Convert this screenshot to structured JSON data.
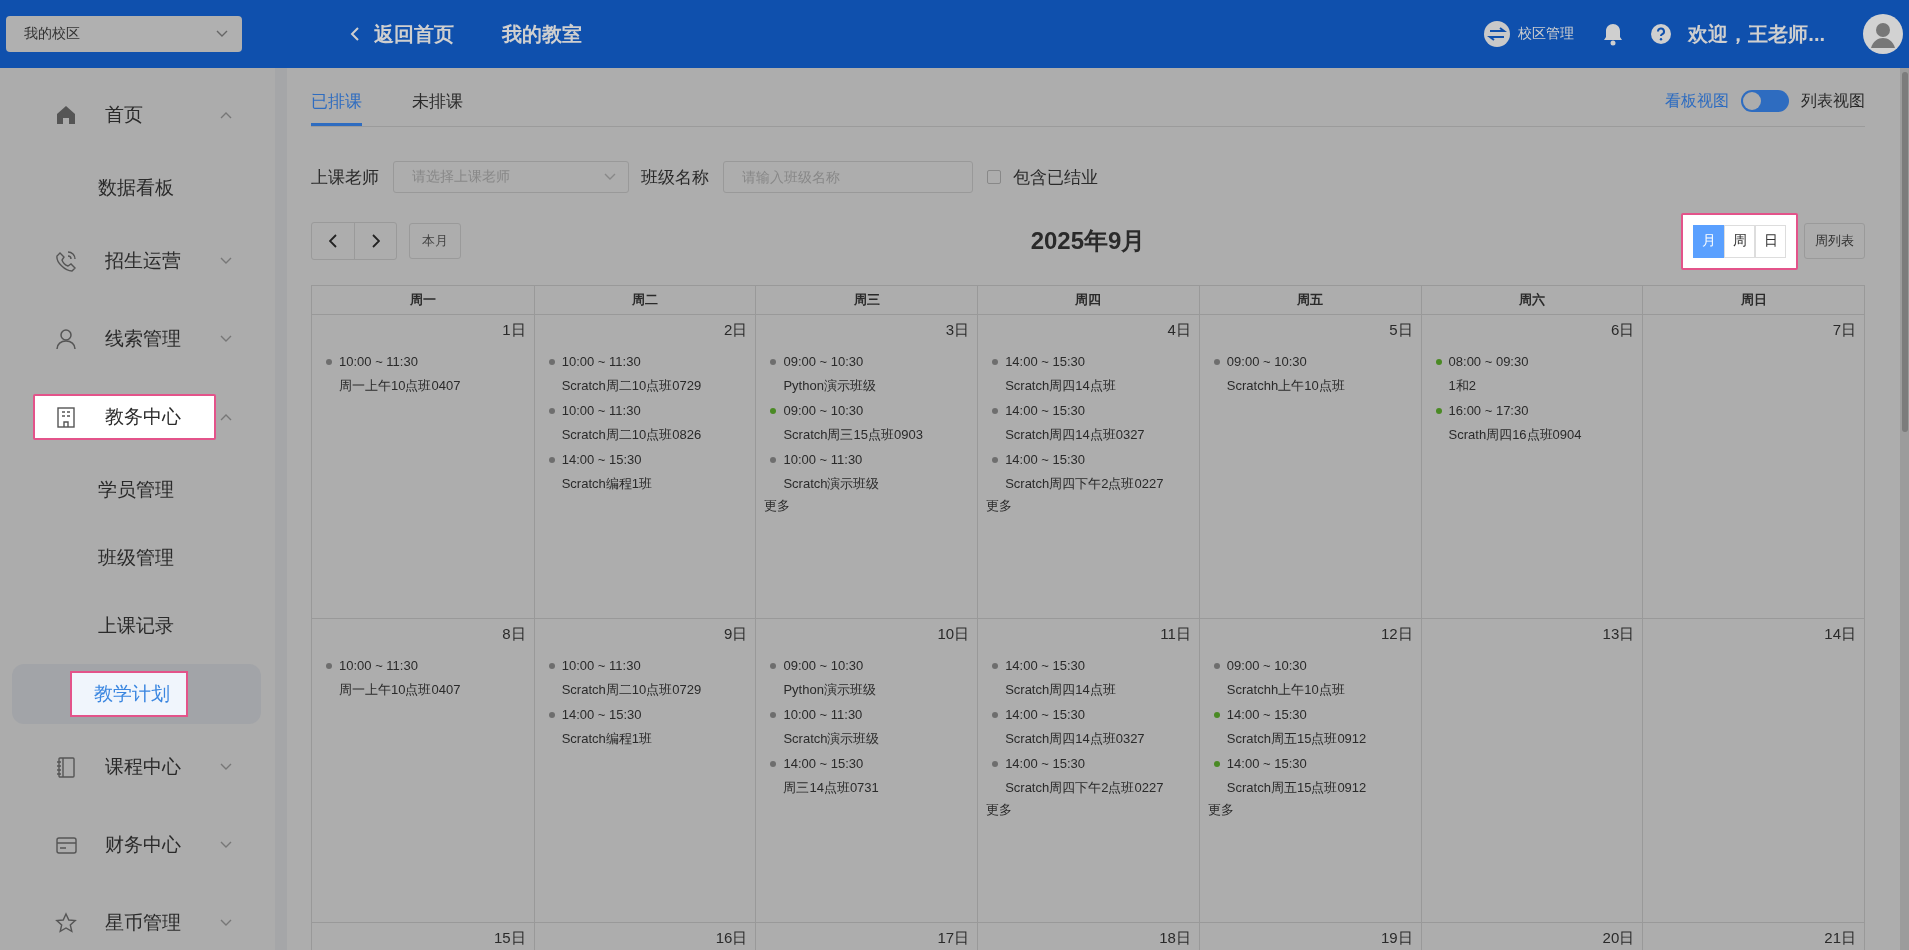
{
  "topbar": {
    "campus_select": {
      "value": "我的校区"
    },
    "back_link": "返回首页",
    "title": "我的教室",
    "campus_manage": "校区管理",
    "greeting": "欢迎，王老师..."
  },
  "sidebar": {
    "items": [
      {
        "label": "首页",
        "expanded": true,
        "highlighted": false,
        "children": [
          {
            "label": "数据看板",
            "selected": false,
            "highlighted": false
          }
        ]
      },
      {
        "label": "招生运营",
        "expanded": false,
        "highlighted": false
      },
      {
        "label": "线索管理",
        "expanded": false,
        "highlighted": false
      },
      {
        "label": "教务中心",
        "expanded": true,
        "highlighted": true,
        "children": [
          {
            "label": "学员管理",
            "selected": false,
            "highlighted": false
          },
          {
            "label": "班级管理",
            "selected": false,
            "highlighted": false
          },
          {
            "label": "上课记录",
            "selected": false,
            "highlighted": false
          },
          {
            "label": "教学计划",
            "selected": true,
            "highlighted": true
          }
        ]
      },
      {
        "label": "课程中心",
        "expanded": false,
        "highlighted": false
      },
      {
        "label": "财务中心",
        "expanded": false,
        "highlighted": false
      },
      {
        "label": "星币管理",
        "expanded": false,
        "highlighted": false
      }
    ]
  },
  "tabs": [
    {
      "label": "已排课",
      "selected": true
    },
    {
      "label": "未排课",
      "selected": false
    }
  ],
  "view_toggle": {
    "left_label": "看板视图",
    "right_label": "列表视图",
    "on": false
  },
  "filters": {
    "teacher_label": "上课老师",
    "teacher_select": {
      "placeholder": "请选择上课老师"
    },
    "class_label": "班级名称",
    "class_input": {
      "placeholder": "请输入班级名称"
    },
    "include_graduated": {
      "label": "包含已结业",
      "checked": false
    }
  },
  "calendar": {
    "today_button": "本月",
    "title": "2025年9月",
    "view_switch": {
      "highlighted": true,
      "options": [
        {
          "label": "月",
          "selected": true
        },
        {
          "label": "周",
          "selected": false
        },
        {
          "label": "日",
          "selected": false
        }
      ]
    },
    "week_list_button": "周列表",
    "weekdays": [
      "周一",
      "周二",
      "周三",
      "周四",
      "周五",
      "周六",
      "周日"
    ],
    "weeks": [
      {
        "days": [
          {
            "date": "1日",
            "events": [
              {
                "time": "10:00 ~ 11:30",
                "name": "周一上午10点班0407",
                "color": "#6e6e6e"
              }
            ]
          },
          {
            "date": "2日",
            "events": [
              {
                "time": "10:00 ~ 11:30",
                "name": "Scratch周二10点班0729",
                "color": "#6e6e6e"
              },
              {
                "time": "10:00 ~ 11:30",
                "name": "Scratch周二10点班0826",
                "color": "#6e6e6e"
              },
              {
                "time": "14:00 ~ 15:30",
                "name": "Scratch编程1班",
                "color": "#6e6e6e"
              }
            ]
          },
          {
            "date": "3日",
            "events": [
              {
                "time": "09:00 ~ 10:30",
                "name": "Python演示班级",
                "color": "#6e6e6e"
              },
              {
                "time": "09:00 ~ 10:30",
                "name": "Scratch周三15点班0903",
                "color": "#4a8a24"
              },
              {
                "time": "10:00 ~ 11:30",
                "name": "Scratch演示班级",
                "color": "#6e6e6e"
              }
            ],
            "more": "更多"
          },
          {
            "date": "4日",
            "events": [
              {
                "time": "14:00 ~ 15:30",
                "name": "Scratch周四14点班",
                "color": "#6e6e6e"
              },
              {
                "time": "14:00 ~ 15:30",
                "name": "Scratch周四14点班0327",
                "color": "#6e6e6e"
              },
              {
                "time": "14:00 ~ 15:30",
                "name": "Scratch周四下午2点班0227",
                "color": "#6e6e6e"
              }
            ],
            "more": "更多"
          },
          {
            "date": "5日",
            "events": [
              {
                "time": "09:00 ~ 10:30",
                "name": "Scratchh上午10点班",
                "color": "#6e6e6e"
              }
            ]
          },
          {
            "date": "6日",
            "events": [
              {
                "time": "08:00 ~ 09:30",
                "name": "1和2",
                "color": "#4a8a24"
              },
              {
                "time": "16:00 ~ 17:30",
                "name": "Scrath周四16点班0904",
                "color": "#4a8a24"
              }
            ]
          },
          {
            "date": "7日"
          }
        ]
      },
      {
        "days": [
          {
            "date": "8日",
            "events": [
              {
                "time": "10:00 ~ 11:30",
                "name": "周一上午10点班0407",
                "color": "#6e6e6e"
              }
            ]
          },
          {
            "date": "9日",
            "events": [
              {
                "time": "10:00 ~ 11:30",
                "name": "Scratch周二10点班0729",
                "color": "#6e6e6e"
              },
              {
                "time": "14:00 ~ 15:30",
                "name": "Scratch编程1班",
                "color": "#6e6e6e"
              }
            ]
          },
          {
            "date": "10日",
            "events": [
              {
                "time": "09:00 ~ 10:30",
                "name": "Python演示班级",
                "color": "#6e6e6e"
              },
              {
                "time": "10:00 ~ 11:30",
                "name": "Scratch演示班级",
                "color": "#6e6e6e"
              },
              {
                "time": "14:00 ~ 15:30",
                "name": "周三14点班0731",
                "color": "#6e6e6e"
              }
            ]
          },
          {
            "date": "11日",
            "events": [
              {
                "time": "14:00 ~ 15:30",
                "name": "Scratch周四14点班",
                "color": "#6e6e6e"
              },
              {
                "time": "14:00 ~ 15:30",
                "name": "Scratch周四14点班0327",
                "color": "#6e6e6e"
              },
              {
                "time": "14:00 ~ 15:30",
                "name": "Scratch周四下午2点班0227",
                "color": "#6e6e6e"
              }
            ],
            "more": "更多"
          },
          {
            "date": "12日",
            "events": [
              {
                "time": "09:00 ~ 10:30",
                "name": "Scratchh上午10点班",
                "color": "#6e6e6e"
              },
              {
                "time": "14:00 ~ 15:30",
                "name": "Scratch周五15点班0912",
                "color": "#4a8a24"
              },
              {
                "time": "14:00 ~ 15:30",
                "name": "Scratch周五15点班0912",
                "color": "#4a8a24"
              }
            ],
            "more": "更多"
          },
          {
            "date": "13日"
          },
          {
            "date": "14日"
          }
        ]
      },
      {
        "days": [
          {
            "date": "15日"
          },
          {
            "date": "16日"
          },
          {
            "date": "17日"
          },
          {
            "date": "18日"
          },
          {
            "date": "19日"
          },
          {
            "date": "20日"
          },
          {
            "date": "21日"
          }
        ]
      }
    ]
  }
}
